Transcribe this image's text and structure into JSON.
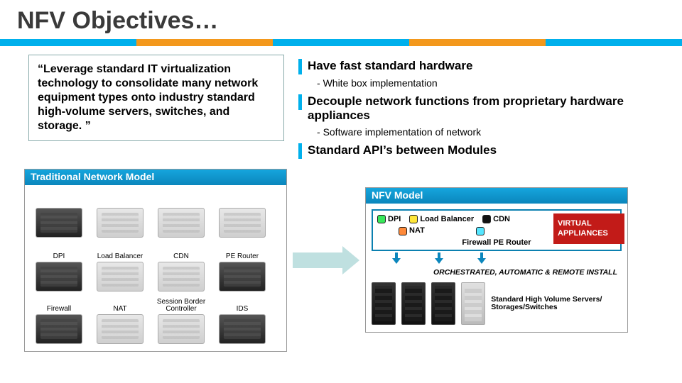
{
  "title": "NFV Objectives…",
  "stripe_colors": [
    "#00b0ec",
    "#f3981c",
    "#00b0ec",
    "#f3981c",
    "#00b0ec"
  ],
  "quote": "“Leverage standard IT virtualization technology to consolidate many network equipment types onto industry standard high-volume servers, switches, and storage. ”",
  "objectives": [
    {
      "heading": "Have fast standard hardware",
      "sub": "White box implementation"
    },
    {
      "heading": "Decouple network functions from proprietary hardware appliances",
      "sub": "Software implementation of network"
    },
    {
      "heading": "Standard API’s between Modules",
      "sub": null
    }
  ],
  "trad": {
    "title": "Traditional Network Model",
    "items": [
      "",
      "",
      "",
      "",
      "DPI",
      "Load Balancer",
      "CDN",
      "PE Router",
      "Firewall",
      "NAT",
      "Session Border Controller",
      "IDS"
    ]
  },
  "nfv": {
    "title": "NFV Model",
    "vf": {
      "dpi": "DPI",
      "nat": "NAT",
      "lb": "Load Balancer",
      "cdn": "CDN",
      "fw_pe": "Firewall PE Router"
    },
    "va_label": "VIRTUAL APPLIANCES",
    "orch": "ORCHESTRATED, AUTOMATIC & REMOTE INSTALL",
    "srv_caption": "Standard High Volume Servers/ Storages/Switches"
  }
}
